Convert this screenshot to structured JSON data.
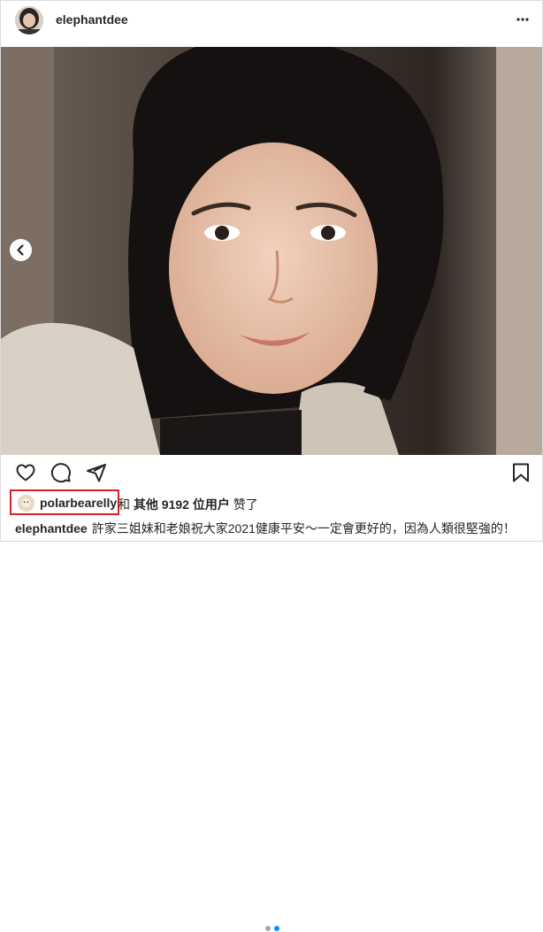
{
  "post": {
    "username": "elephantdee",
    "icons": {
      "more": "more-horizontal-icon",
      "prev": "chevron-left-icon",
      "like": "heart-icon",
      "comment": "comment-icon",
      "share": "share-icon",
      "save": "bookmark-icon"
    },
    "carousel": {
      "count": 2,
      "active_index": 1
    }
  },
  "likes": {
    "liker": "polarbearelly",
    "and": "和",
    "others": "其他 9192 位用户",
    "suffix": "赞了"
  },
  "caption": {
    "username": "elephantdee",
    "text": "許家三姐妹和老娘祝大家2021健康平安～一定會更好的，因為人類很堅強的！"
  },
  "colors": {
    "highlight": "#e02020",
    "active_dot": "#0095f6",
    "inactive_dot": "#a8a8a8"
  }
}
